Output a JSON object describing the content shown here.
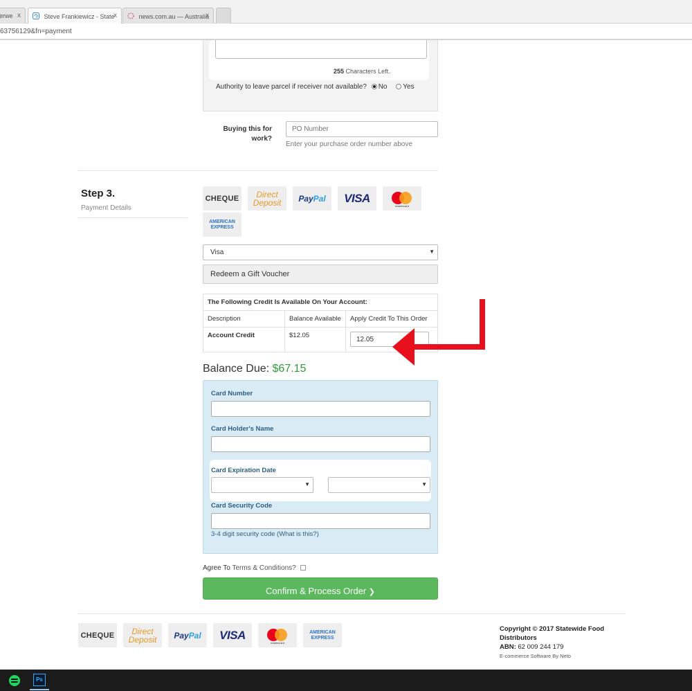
{
  "browser": {
    "tabs": [
      {
        "title": "erwe"
      },
      {
        "title": "Steve Frankiewicz - State"
      },
      {
        "title": "news.com.au — Australia"
      }
    ],
    "close_glyph": "x",
    "url": "63756129&fn=payment"
  },
  "delivery": {
    "chars_left_count": "255",
    "chars_left_text": "Characters Left.",
    "authority_label": "Authority to leave parcel if receiver not available?",
    "option_no": "No",
    "option_yes": "Yes",
    "selected_option": "No"
  },
  "po": {
    "label_line1": "Buying this for",
    "label_line2": "work?",
    "placeholder": "PO Number",
    "help": "Enter your purchase order number above"
  },
  "step3": {
    "title": "Step 3.",
    "subtitle": "Payment Details"
  },
  "payment_methods": {
    "cheque": "CHEQUE",
    "direct_line1": "Direct",
    "direct_line2": "Deposit",
    "paypal_a": "Pay",
    "paypal_b": "Pal",
    "visa": "VISA",
    "mastercard": "mastercard",
    "amex_line1": "AMERICAN",
    "amex_line2": "EXPRESS"
  },
  "payment_select": {
    "value": "Visa",
    "arrow": "▼"
  },
  "voucher_button": "Redeem a Gift Voucher",
  "credit": {
    "heading": "The Following Credit Is Available On Your Account:",
    "col_description": "Description",
    "col_balance": "Balance Available",
    "col_apply": "Apply Credit To This Order",
    "row_description": "Account Credit",
    "row_balance": "$12.05",
    "row_apply_value": "12.05"
  },
  "balance": {
    "label": "Balance Due:",
    "amount": "$67.15"
  },
  "card": {
    "number_label": "Card Number",
    "holder_label": "Card Holder's Name",
    "expiry_label": "Card Expiration Date",
    "security_label": "Card Security Code",
    "security_help": "3-4 digit security code (What is this?)",
    "select_arrow": "▼"
  },
  "agree": {
    "prefix": "Agree To",
    "link": "Terms & Conditions?"
  },
  "confirm_button": "Confirm & Process Order",
  "confirm_chevron": "❯",
  "footer": {
    "copyright_line1": "Copyright © 2017 Statewide Food",
    "copyright_line2": "Distributors",
    "abn_label": "ABN:",
    "abn_value": "62 009 244 179",
    "software": "E-commerce Software By Neto"
  },
  "taskbar": {
    "ps_label": "Ps"
  },
  "colors": {
    "confirm_green": "#5cb85c",
    "balance_green": "#2e9b39",
    "card_panel": "#d9ecf6",
    "annotation_arrow": "#e8101c"
  },
  "icons": [
    "spotify-icon",
    "photoshop-icon",
    "red-annotation-arrow"
  ]
}
